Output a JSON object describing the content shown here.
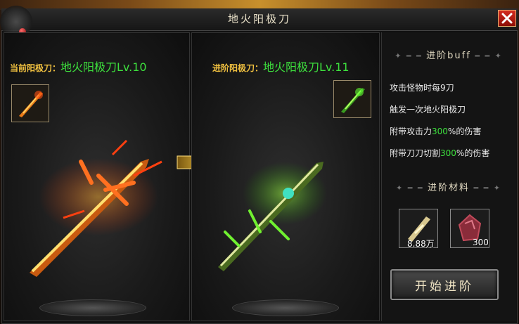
{
  "window": {
    "title": "地火阳极刀"
  },
  "current": {
    "prefix": "当前阳极刀：",
    "name": "地火阳极刀Lv.10"
  },
  "next": {
    "prefix": "进阶阳极刀：",
    "name": "地火阳极刀Lv.11"
  },
  "buff": {
    "header": "进阶buff",
    "lines": [
      {
        "text": "攻击怪物时每9刀"
      },
      {
        "text": "触发一次地火阳极刀"
      },
      {
        "before": "附带攻击力",
        "value": "300",
        "after": "%的伤害"
      },
      {
        "before": "附带刀刀切割",
        "value": "300",
        "after": "%的伤害"
      }
    ]
  },
  "materials": {
    "header": "进阶材料",
    "items": [
      {
        "icon": "gold-ingot-icon",
        "count": "8.88万"
      },
      {
        "icon": "red-gem-icon",
        "count": "300"
      }
    ]
  },
  "start_button": "开始进阶",
  "colors": {
    "green": "#3de03d",
    "gold": "#f0c040"
  }
}
